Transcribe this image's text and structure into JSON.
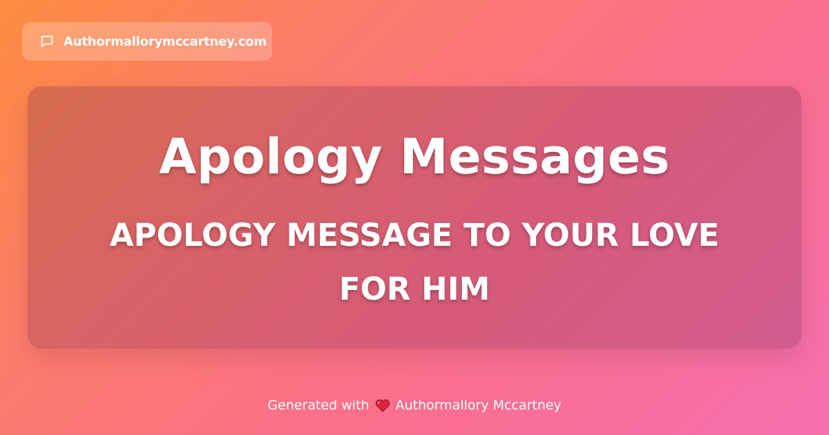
{
  "site_badge": {
    "icon": "message-icon",
    "text": "Authormallorymccartney.com"
  },
  "card": {
    "title": "Apology Messages",
    "subtitle": "APOLOGY MESSAGE TO YOUR LOVE FOR HIM"
  },
  "footer": {
    "prefix": "Generated with",
    "icon": "heart-icon",
    "author": "Authormallory Mccartney"
  },
  "colors": {
    "gradient_start": "#fd8c3f",
    "gradient_end": "#f56fae",
    "heart": "#e0233c",
    "text": "#ffffff"
  }
}
